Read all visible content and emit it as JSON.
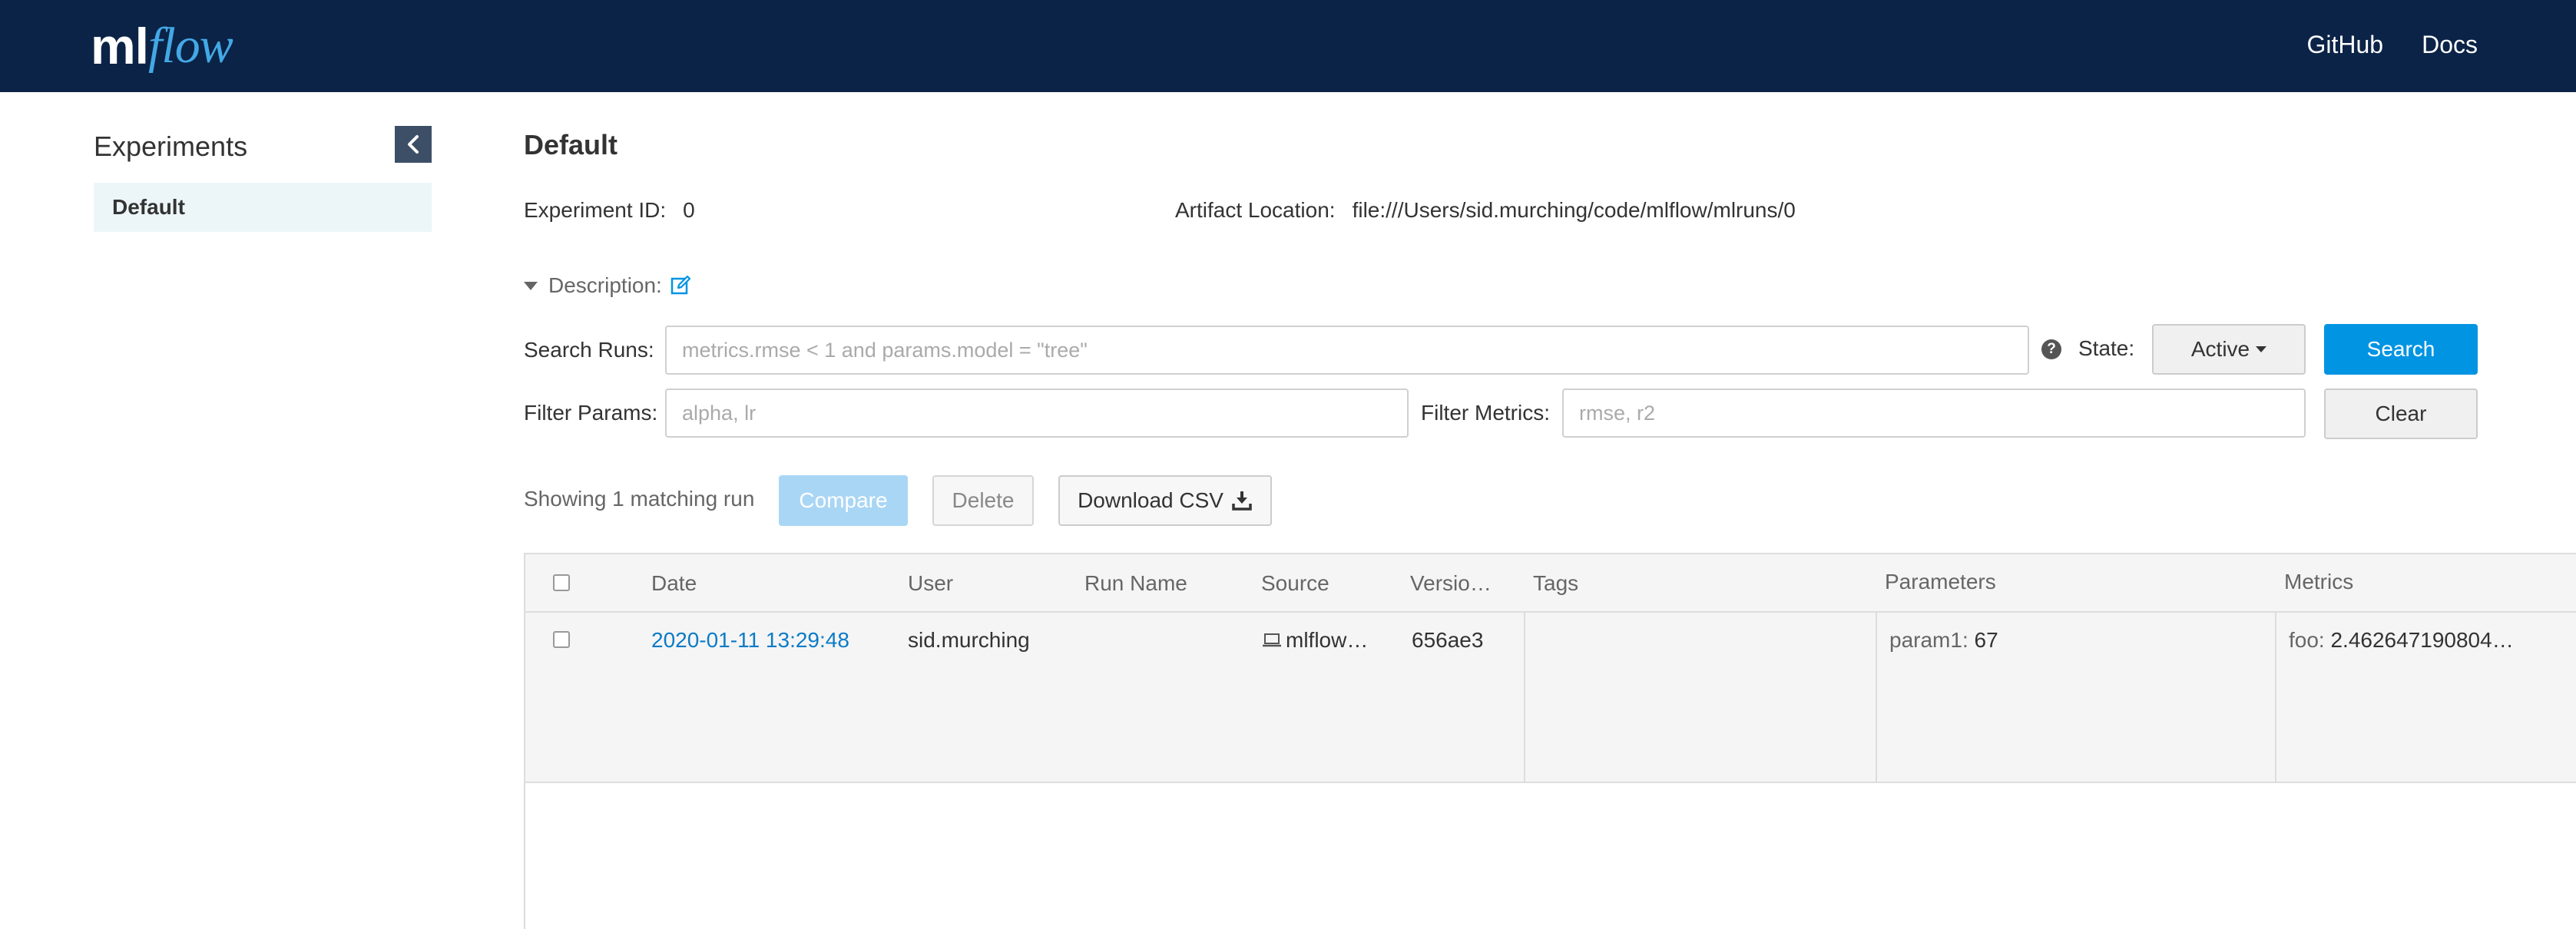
{
  "header": {
    "logo_ml": "ml",
    "logo_flow": "flow",
    "nav": [
      "GitHub",
      "Docs"
    ]
  },
  "sidebar": {
    "title": "Experiments",
    "items": [
      {
        "label": "Default",
        "selected": true
      }
    ]
  },
  "main": {
    "title": "Default",
    "experiment_id_label": "Experiment ID:",
    "experiment_id": "0",
    "artifact_location_label": "Artifact Location:",
    "artifact_location": "file:///Users/sid.murching/code/mlflow/mlruns/0",
    "description_label": "Description:",
    "search_label": "Search Runs:",
    "search_placeholder": "metrics.rmse < 1 and params.model = \"tree\"",
    "state_label": "State:",
    "state_value": "Active",
    "search_button": "Search",
    "filter_params_label": "Filter Params:",
    "filter_params_placeholder": "alpha, lr",
    "filter_metrics_label": "Filter Metrics:",
    "filter_metrics_placeholder": "rmse, r2",
    "clear_button": "Clear",
    "showing_text": "Showing 1 matching run",
    "compare_button": "Compare",
    "delete_button": "Delete",
    "download_button": "Download CSV"
  },
  "table": {
    "columns": {
      "date": "Date",
      "user": "User",
      "run_name": "Run Name",
      "source": "Source",
      "version": "Versio…",
      "tags": "Tags",
      "parameters": "Parameters",
      "metrics": "Metrics"
    },
    "rows": [
      {
        "date": "2020-01-11 13:29:48",
        "user": "sid.murching",
        "run_name": "",
        "source": "mlflow…",
        "version": "656ae3",
        "tags": "",
        "param_key": "param1:",
        "param_value": "67",
        "metric_key": "foo:",
        "metric_value": "2.462647190804…"
      }
    ]
  },
  "colors": {
    "header_bg": "#0b2347",
    "accent": "#0194e2",
    "link": "#0c7bc7",
    "sidebar_selected": "#ecf6f9"
  }
}
